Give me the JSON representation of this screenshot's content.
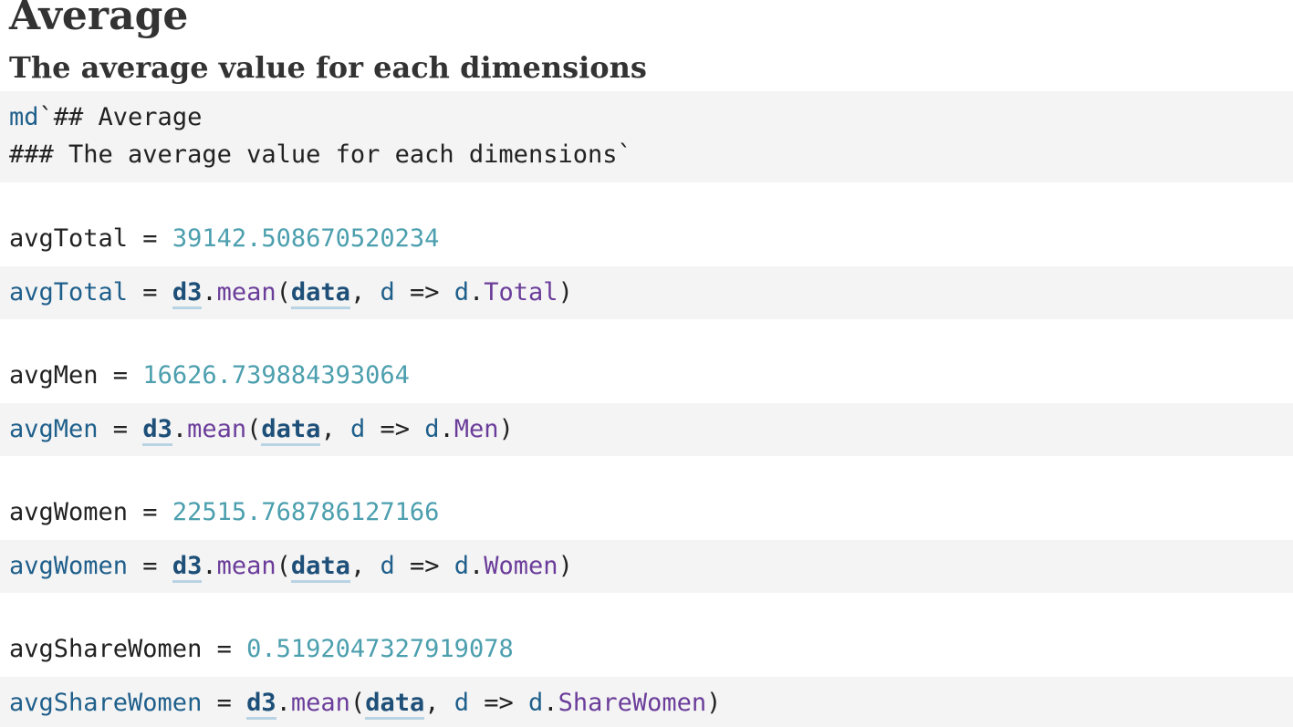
{
  "markdown_cell": {
    "rendered_h2": "Average",
    "rendered_h3": "The average value for each dimensions",
    "source_prefix": "md",
    "source_line1": "`## Average",
    "source_line2": "### The average value for each dimensions`"
  },
  "cells": [
    {
      "name": "avgTotal",
      "value": "39142.508670520234",
      "field": "Total"
    },
    {
      "name": "avgMen",
      "value": "16626.739884393064",
      "field": "Men"
    },
    {
      "name": "avgWomen",
      "value": "22515.768786127166",
      "field": "Women"
    },
    {
      "name": "avgShareWomen",
      "value": "0.5192047327919078",
      "field": "ShareWomen"
    }
  ],
  "code_tokens": {
    "equals": " = ",
    "lib": "d3",
    "dot": ".",
    "fn": "mean",
    "open": "(",
    "arg": "data",
    "comma_space": ", ",
    "param": "d",
    "arrow": " => ",
    "close": ")"
  },
  "colors": {
    "code_background": "#f4f4f4",
    "number": "#4c9fae",
    "identifier": "#1f5f8b",
    "reference": "#1d4f78",
    "property": "#6b3d9a",
    "text": "#222222"
  }
}
